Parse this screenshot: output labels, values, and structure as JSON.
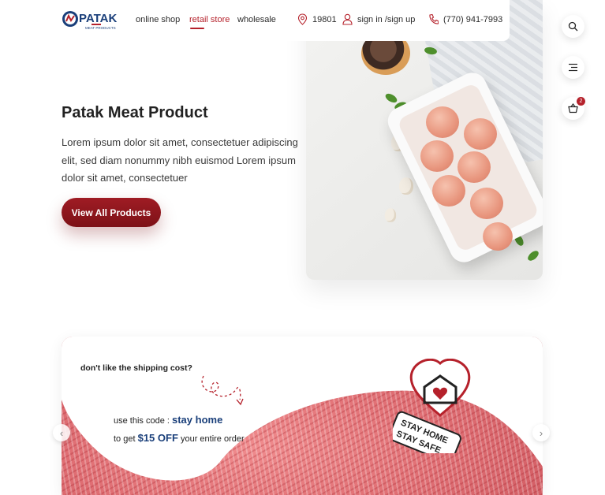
{
  "brand": {
    "name": "PATAK",
    "tagline": "MEAT PRODUCTS",
    "colors": {
      "accent": "#b5212b",
      "navy": "#1a3f7a"
    }
  },
  "nav": {
    "links": [
      {
        "label": "online shop"
      },
      {
        "label": "retail store",
        "active": true
      },
      {
        "label": "wholesale"
      }
    ],
    "location": {
      "icon": "location-pin-icon",
      "label": "19801"
    },
    "account": {
      "icon": "user-icon",
      "label": "sign in /sign up"
    },
    "phone": {
      "icon": "phone-icon",
      "label": "(770) 941-7993"
    }
  },
  "side_actions": [
    {
      "icon": "search-icon"
    },
    {
      "icon": "menu-icon"
    },
    {
      "icon": "cart-icon",
      "badge": "2"
    }
  ],
  "hero": {
    "title": "Patak Meat Product",
    "description": "Lorem ipsum dolor sit amet, consectetuer adipiscing elit, sed diam nonummy nibh euismod Lorem ipsum dolor sit amet, consectetuer",
    "cta": "View All Products"
  },
  "promo": {
    "question": "don't like the shipping cost?",
    "line1_prefix": "use this code :",
    "code": "stay home",
    "line2_prefix": "to get",
    "discount": "$15 OFF",
    "line2_suffix": "your entire order",
    "stamp_line1": "STAY HOME",
    "stamp_line2": "STAY SAFE"
  },
  "carousel": {
    "prev_icon": "chevron-left-icon",
    "next_icon": "chevron-right-icon"
  }
}
